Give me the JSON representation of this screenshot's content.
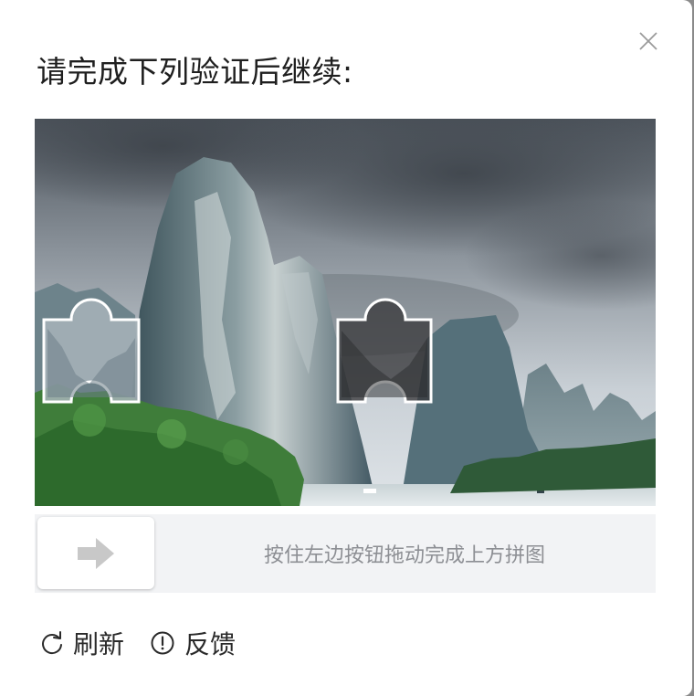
{
  "dialog": {
    "title": "请完成下列验证后继续:",
    "close_icon": "close-icon"
  },
  "slider": {
    "hint": "按住左边按钮拖动完成上方拼图",
    "handle_icon": "arrow-right-icon",
    "progress": 0
  },
  "actions": {
    "refresh_label": "刷新",
    "refresh_icon": "refresh-icon",
    "feedback_label": "反馈",
    "feedback_icon": "alert-circle-icon"
  },
  "colors": {
    "hint_text": "#8d8f94",
    "track": "#f2f3f5",
    "icon_gray": "#c8c8c8"
  }
}
